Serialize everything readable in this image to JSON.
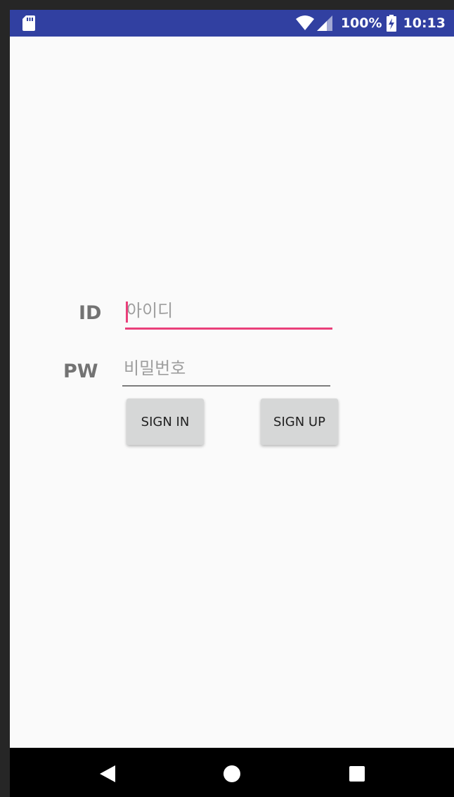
{
  "status_bar": {
    "battery_percent": "100%",
    "time": "10:13",
    "background_color": "#3140a1",
    "icons": [
      "sd-card-icon",
      "wifi-icon",
      "cell-signal-icon",
      "battery-charging-icon"
    ]
  },
  "login_form": {
    "id_label": "ID",
    "id_placeholder": "아이디",
    "id_value": "",
    "pw_label": "PW",
    "pw_placeholder": "비밀번호",
    "pw_value": "",
    "accent_color": "#ea3f7a"
  },
  "buttons": {
    "sign_in": "SIGN IN",
    "sign_up": "SIGN UP"
  },
  "nav_bar": {
    "icons": [
      "back-icon",
      "home-icon",
      "recents-icon"
    ]
  }
}
